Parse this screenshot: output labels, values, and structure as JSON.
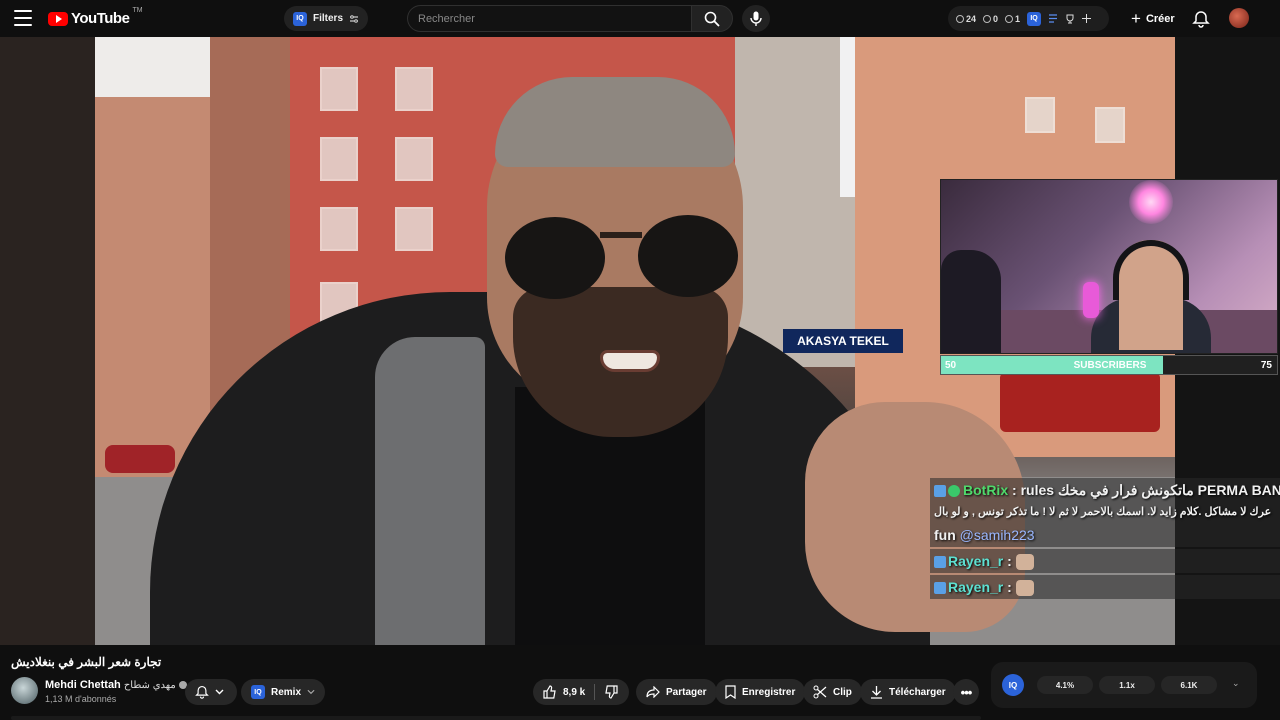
{
  "header": {
    "logo_text": "YouTube",
    "logo_tm": "TM",
    "filters_badge": "IQ",
    "filters_label": "Filters",
    "search_placeholder": "Rechercher",
    "stats": [
      {
        "icon": "clock-icon",
        "value": "24"
      },
      {
        "icon": "eye-icon",
        "value": "0"
      },
      {
        "icon": "eye-icon",
        "value": "1"
      }
    ],
    "stats_badge": "IQ",
    "create_label": "Créer",
    "icons": [
      "menu-icon",
      "search-icon",
      "mic-icon",
      "bell-icon",
      "avatar"
    ]
  },
  "stream_overlay": {
    "sign_text": "AKASYA TEKEL",
    "subs_bar": {
      "start": "50",
      "label": "SUBSCRIBERS",
      "end": "75",
      "progress": 0.66
    }
  },
  "chat": {
    "lines": [
      {
        "user": "BotRix",
        "sep": " : ",
        "text": "rules ماتكونش فرار في مخك PERMA BAN احترم"
      },
      {
        "user": "",
        "sep": "",
        "text": "عرك لا مشاكل .كلام زايد لا. اسمك بالاحمر لا ثم لا ! ما تذكر تونس , و لو بال"
      },
      {
        "user": "",
        "sep": "",
        "text": "fun",
        "mention": "@samih223"
      },
      {
        "user": "Rayen_r",
        "sep": " : ",
        "text": ""
      },
      {
        "user": "Rayen_r",
        "sep": " : ",
        "text": ""
      }
    ]
  },
  "video_info": {
    "title": "تجارة شعر البشر في بنغلاديش",
    "channel_name": "Mehdi Chettah",
    "channel_alt": "مهدي شطاح",
    "subscribers": "1,13 M d'abonnés",
    "remix_badge": "IQ",
    "remix_label": "Remix",
    "likes": "8,9 k",
    "share_label": "Partager",
    "save_label": "Enregistrer",
    "clip_label": "Clip",
    "download_label": "Télécharger"
  },
  "iq_panel": {
    "badge": "IQ",
    "values": [
      "4.1%",
      "1.1x",
      "6.1K"
    ]
  },
  "colors": {
    "accent_red": "#ff0000",
    "iq_blue": "#2b63d9",
    "subs_green": "#7de4c1",
    "botrix_green": "#4fd96b",
    "rayen_teal": "#5de0d1"
  }
}
